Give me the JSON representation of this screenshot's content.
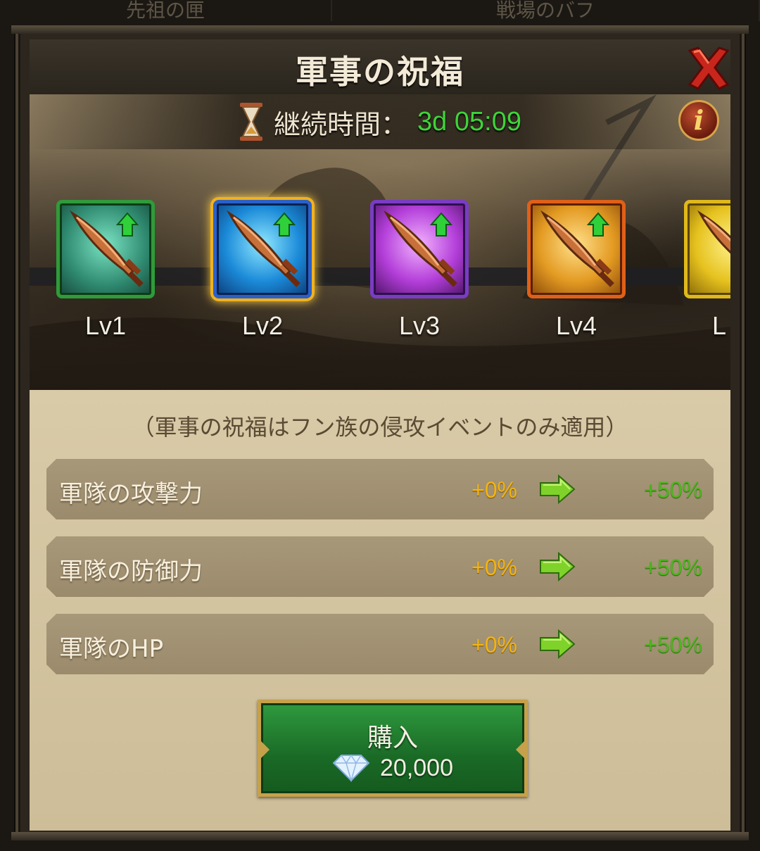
{
  "background_tabs": [
    "先祖の匣",
    "戦場のバフ"
  ],
  "dialog": {
    "title": "軍事の祝福",
    "timer_label": "継続時間：",
    "timer_value": "3d 05:09",
    "levels": [
      {
        "label": "Lv1",
        "rarity": "green"
      },
      {
        "label": "Lv2",
        "rarity": "blue",
        "selected": true
      },
      {
        "label": "Lv3",
        "rarity": "purple"
      },
      {
        "label": "Lv4",
        "rarity": "orange"
      },
      {
        "label": "L",
        "rarity": "gold"
      }
    ],
    "note": "（軍事の祝福はフン族の侵攻イベントのみ適用）",
    "stats": [
      {
        "name": "軍隊の攻撃力",
        "current": "+0%",
        "next": "+50%"
      },
      {
        "name": "軍隊の防御力",
        "current": "+0%",
        "next": "+50%"
      },
      {
        "name": "軍隊のHP",
        "current": "+0%",
        "next": "+50%"
      }
    ],
    "buy": {
      "label": "購入",
      "cost": "20,000",
      "currency_icon": "diamond-icon"
    }
  },
  "colors": {
    "timer_value": "#3fd33a",
    "stat_current": "#f3b414",
    "stat_next": "#4fb51f",
    "buy_button": "#1a6a26"
  }
}
